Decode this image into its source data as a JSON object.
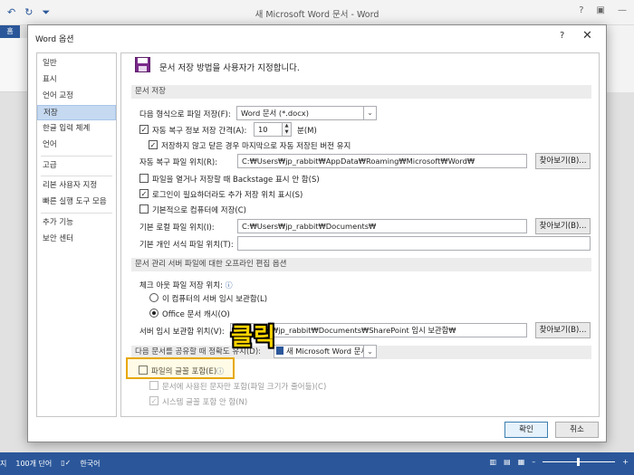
{
  "window": {
    "title": "새 Microsoft Word 문서 - Word",
    "help": "?",
    "home_tab": "홈"
  },
  "dialog": {
    "title": "Word 옵션",
    "help": "?",
    "close": "✕"
  },
  "nav": {
    "items": [
      {
        "label": "일반"
      },
      {
        "label": "표시"
      },
      {
        "label": "언어 교정"
      },
      {
        "label": "저장",
        "selected": true
      },
      {
        "label": "한글 입력 체계"
      },
      {
        "label": "언어"
      },
      {
        "label": "고급"
      },
      {
        "label": "리본 사용자 지정"
      },
      {
        "label": "빠른 실행 도구 모음"
      },
      {
        "label": "추가 기능"
      },
      {
        "label": "보안 센터"
      }
    ]
  },
  "header": {
    "text": "문서 저장 방법을 사용자가 지정합니다.",
    "icon": "save-icon"
  },
  "save_section": {
    "title": "문서 저장",
    "format_label": "다음 형식으로 파일 저장(F):",
    "format_value": "Word 문서 (*.docx)",
    "autorecover_label": "자동 복구 정보 저장 간격(A):",
    "autorecover_checked": true,
    "autorecover_minutes": "10",
    "minutes_unit": "분(M)",
    "keep_last_label": "저장하지 않고 닫은 경우 마지막으로 자동 저장된 버전 유지",
    "keep_last_checked": true,
    "autorecover_location_label": "자동 복구 파일 위치(R):",
    "autorecover_location_value": "C:₩Users₩jp_rabbit₩AppData₩Roaming₩Microsoft₩Word₩",
    "browse1": "찾아보기(B)...",
    "no_backstage_label": "파일을 열거나 저장할 때 Backstage 표시 안 함(S)",
    "no_backstage_checked": false,
    "show_more_locations_label": "로그인이 필요하더라도 추가 저장 위치 표시(S)",
    "show_more_locations_checked": true,
    "save_to_computer_label": "기본적으로 컴퓨터에 저장(C)",
    "save_to_computer_checked": false,
    "default_local_label": "기본 로컬 파일 위치(I):",
    "default_local_value": "C:₩Users₩jp_rabbit₩Documents₩",
    "browse2": "찾아보기(B)...",
    "default_template_label": "기본 개인 서식 파일 위치(T):",
    "default_template_value": ""
  },
  "offline_section": {
    "title": "문서 관리 서버 파일에 대한 오프라인 편집 옵션",
    "checkout_label": "체크 아웃 파일 저장 위치:",
    "radio1_label": "이 컴퓨터의 서버 임시 보관함(L)",
    "radio1_on": false,
    "radio2_label": "Office 문서 캐시(O)",
    "radio2_on": true,
    "server_drafts_label": "서버 임시 보관함 위치(V):",
    "server_drafts_value": "C:₩Users₩jp_rabbit₩Documents₩SharePoint 임시 보관함₩",
    "browse3": "찾아보기(B)..."
  },
  "fidelity_section": {
    "title_before": "다음 문서를 공유할 때 정확도 유지(D):",
    "doc_value": "새 Microsoft Word 문서",
    "embed_fonts_label": "파일의 글꼴 포함(E)",
    "embed_fonts_checked": false,
    "embed_used_only_label": "문서에 사용된 문자만 포함(파일 크기가 줄어듦)(C)",
    "embed_used_only_checked": false,
    "no_common_fonts_label": "시스템 글꼴 포함 안 함(N)",
    "no_common_fonts_checked": true
  },
  "buttons": {
    "ok": "확인",
    "cancel": "취소"
  },
  "annotation": {
    "text": "클릭",
    "color": "#ffd400",
    "box_color": "#e7a800"
  },
  "status": {
    "words": "100개 단어",
    "language": "한국어",
    "page": "지"
  }
}
